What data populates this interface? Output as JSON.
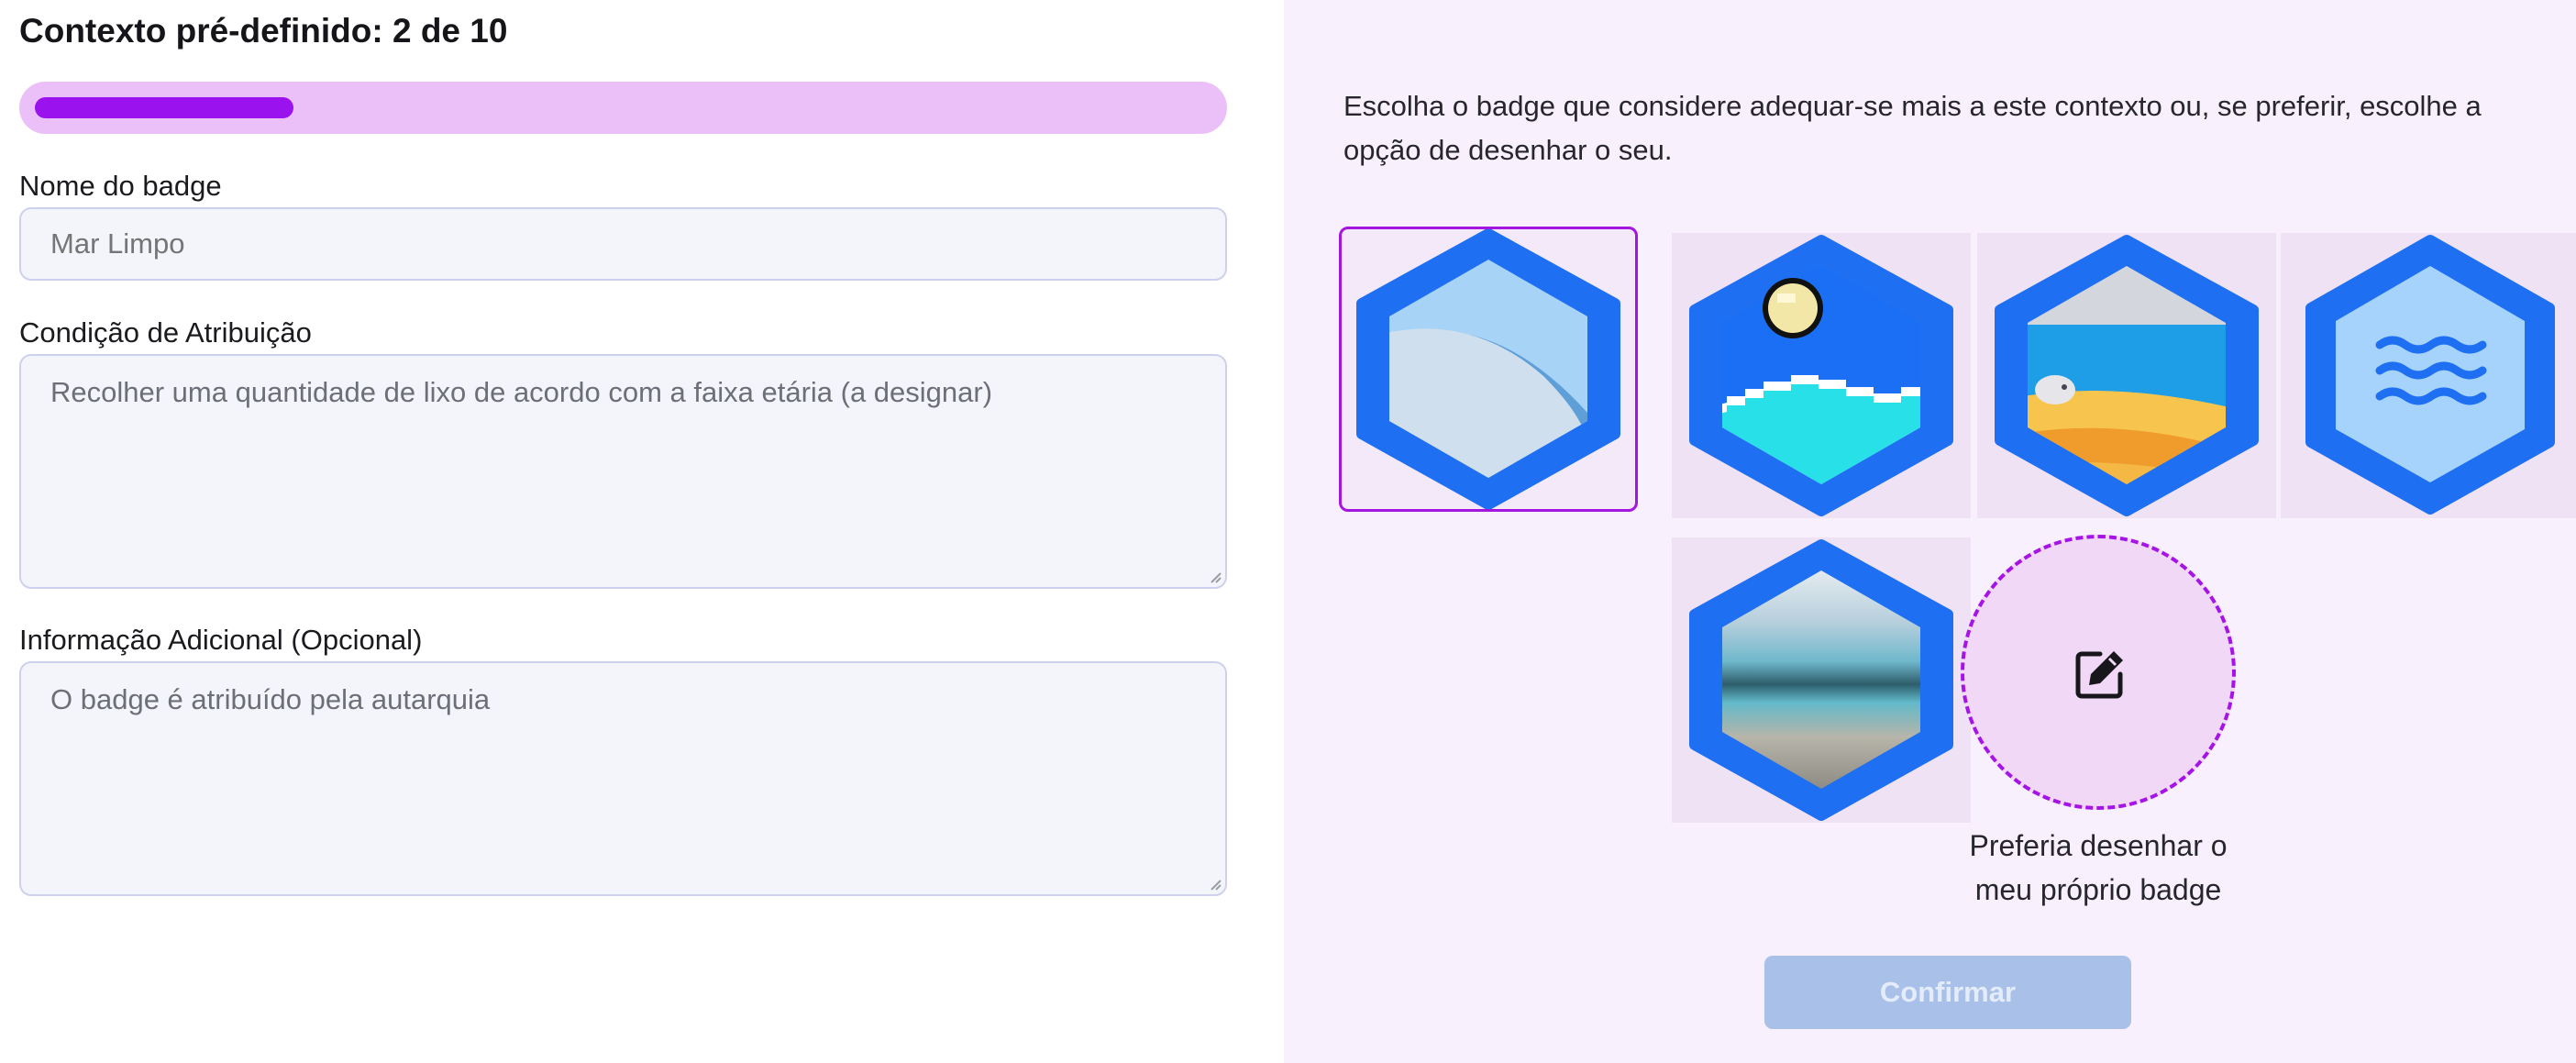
{
  "header": {
    "title": "Contexto pré-definido: 2 de 10",
    "progress": {
      "current": 2,
      "total": 10,
      "fraction": 0.2
    }
  },
  "form": {
    "name": {
      "label": "Nome do badge",
      "placeholder": "Mar Limpo"
    },
    "condition": {
      "label": "Condição de Atribuição",
      "placeholder": "Recolher uma quantidade de lixo de acordo com a faixa etária (a designar)"
    },
    "info": {
      "label": "Informação Adicional (Opcional)",
      "placeholder": "O badge é atribuído pela autarquia"
    }
  },
  "badges": {
    "instructions": "Escolha o badge que considere adequar-se mais a este contexto ou, se preferir, escolhe a opção de desenhar o seu.",
    "options": [
      {
        "icon": "wave-curve-badge-icon",
        "selected": true
      },
      {
        "icon": "pixel-sun-sea-badge-icon",
        "selected": false
      },
      {
        "icon": "beach-fish-badge-icon",
        "selected": false
      },
      {
        "icon": "water-waves-badge-icon",
        "selected": false
      },
      {
        "icon": "blurred-beach-badge-icon",
        "selected": false
      }
    ],
    "draw_own": {
      "icon": "edit-icon",
      "caption_line1": "Preferia desenhar o",
      "caption_line2": "meu próprio badge"
    },
    "confirm_label": "Confirmar"
  },
  "colors": {
    "accent_purple": "#9a12ee",
    "progress_track": "#ebc0f8",
    "badge_blue": "#1e6ff1",
    "right_panel_bg": "#f9f0fd",
    "confirm_disabled": "#a9c0e9"
  }
}
